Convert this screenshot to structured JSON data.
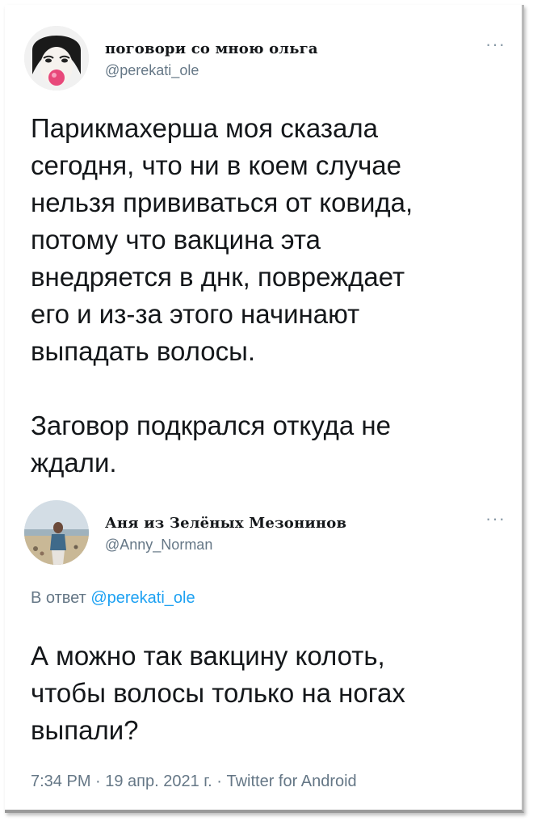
{
  "tweet": {
    "author": {
      "name": "поговори со мною ольга",
      "handle": "@perekati_ole"
    },
    "more_label": "···",
    "text": "Парикмахерша моя сказала\nсегодня, что ни в коем случае\nнельзя прививаться от ковида,\nпотому что вакцина эта\nвнедряется в днк, повреждает\nего и из-за этого начинают\nвыпадать волосы.\n\nЗаговор подкрался откуда не\nждали."
  },
  "reply": {
    "author": {
      "name": "Аня из Зелёных Мезонинов",
      "handle": "@Anny_Norman"
    },
    "more_label": "···",
    "in_reply_prefix": "В ответ",
    "in_reply_handle": "@perekati_ole",
    "text": "А можно так вакцину колоть,\nчтобы волосы только на ногах\nвыпали?",
    "meta": "7:34 PM · 19 апр. 2021 г. · Twitter for Android"
  },
  "colors": {
    "text": "#14171a",
    "secondary": "#657786",
    "link": "#1da1f2",
    "lips": "#e8487a"
  },
  "icons": [
    "more-options-icon",
    "avatar-portrait",
    "avatar-beach-photo"
  ]
}
